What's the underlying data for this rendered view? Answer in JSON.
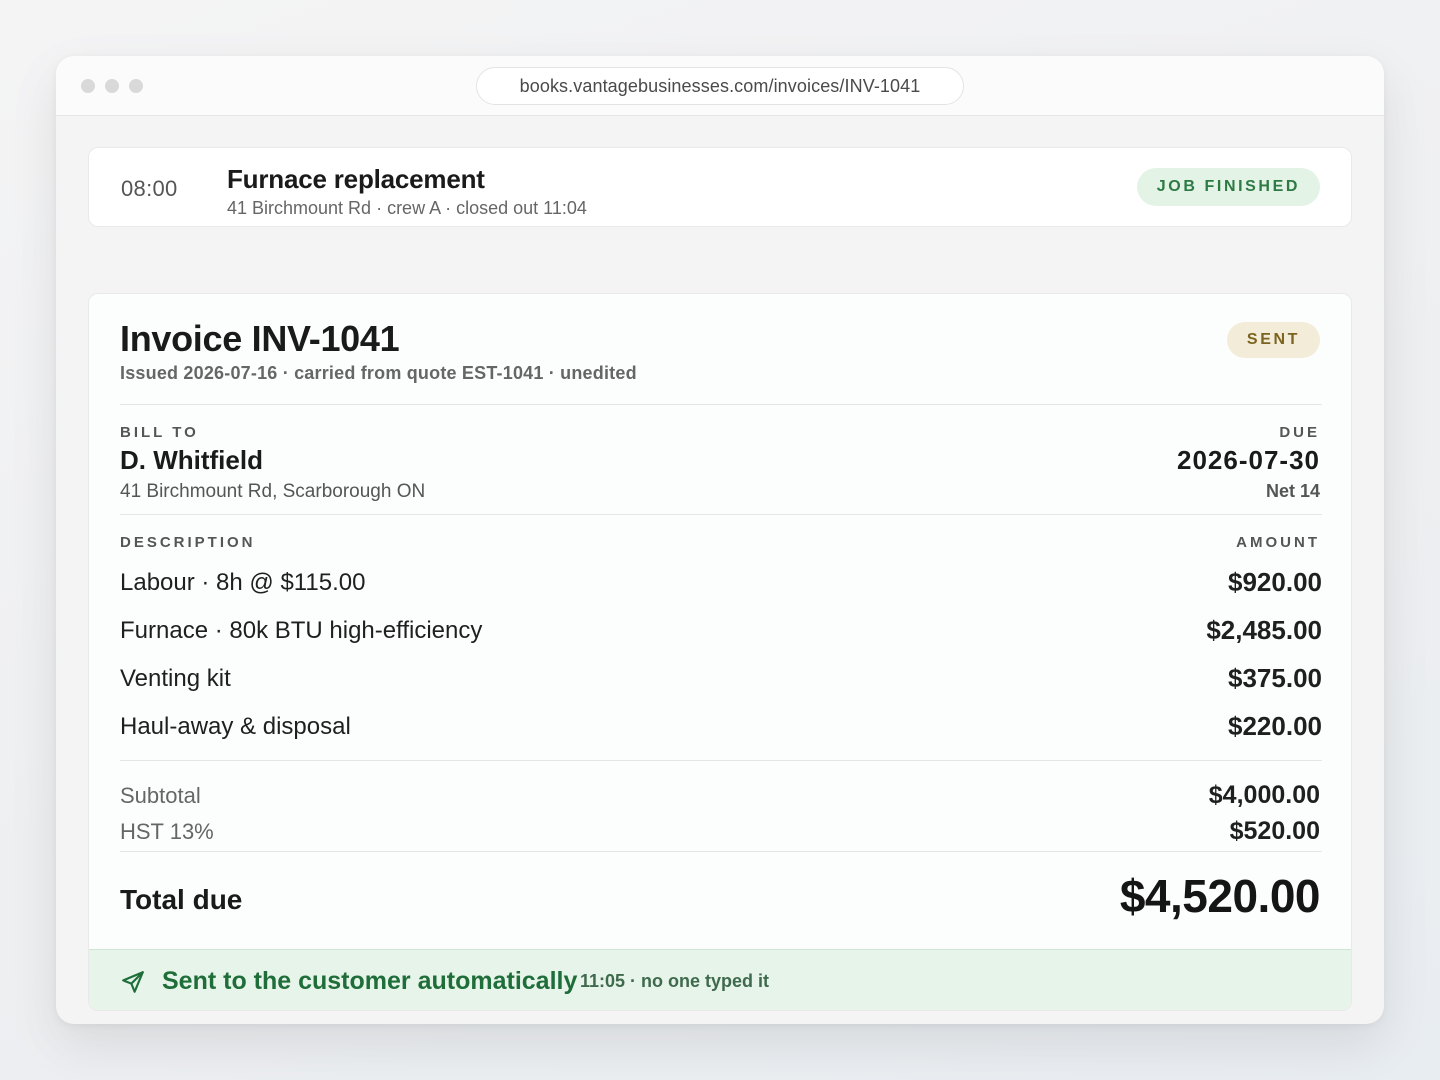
{
  "browser": {
    "url": "books.vantagebusinesses.com/invoices/INV-1041"
  },
  "job": {
    "time": "08:00",
    "title": "Furnace replacement",
    "subtitle": "41 Birchmount Rd · crew A · closed out 11:04",
    "status": "JOB FINISHED"
  },
  "invoice": {
    "title": "Invoice INV-1041",
    "meta": "Issued 2026-07-16 · carried from quote EST-1041 · unedited",
    "status": "SENT",
    "bill_to": {
      "label": "BILL TO",
      "name": "D. Whitfield",
      "address": "41 Birchmount Rd, Scarborough ON"
    },
    "due": {
      "label": "DUE",
      "date": "2026-07-30",
      "terms": "Net 14"
    },
    "columns": {
      "description": "DESCRIPTION",
      "amount": "AMOUNT"
    },
    "line_items": [
      {
        "description": "Labour · 8h @ $115.00",
        "amount": "$920.00"
      },
      {
        "description": "Furnace · 80k BTU high-efficiency",
        "amount": "$2,485.00"
      },
      {
        "description": "Venting kit",
        "amount": "$375.00"
      },
      {
        "description": "Haul-away & disposal",
        "amount": "$220.00"
      }
    ],
    "subtotal": {
      "label": "Subtotal",
      "amount": "$4,000.00"
    },
    "tax": {
      "label": "HST 13%",
      "amount": "$520.00"
    },
    "total": {
      "label": "Total due",
      "amount": "$4,520.00"
    },
    "delivery": {
      "message": "Sent to the customer automatically",
      "meta": "11:05 · no one typed it",
      "icon": "send-icon"
    }
  },
  "colors": {
    "finished_badge_bg": "#e3f3e6",
    "finished_badge_text": "#2d7a44",
    "sent_badge_bg": "#f3ecd8",
    "sent_badge_text": "#7a6420",
    "delivery_bar_bg": "#e7f4ea",
    "delivery_text": "#1f6e3a"
  }
}
